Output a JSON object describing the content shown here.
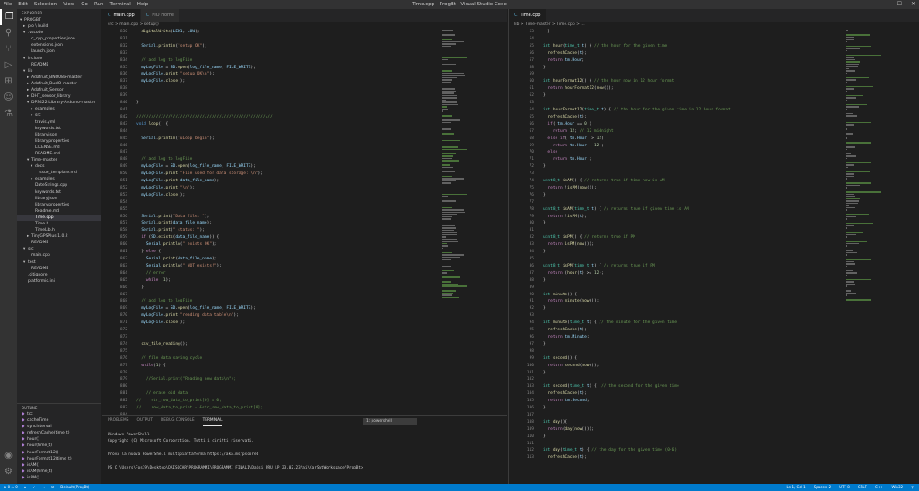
{
  "titlebar": {
    "menu": [
      "File",
      "Edit",
      "Selection",
      "View",
      "Go",
      "Run",
      "Terminal",
      "Help"
    ],
    "title": "Time.cpp - ProgBt - Visual Studio Code"
  },
  "sidebar": {
    "header": "EXPLORER",
    "tree": [
      [
        "▾",
        "PROGBT"
      ],
      [
        "▸",
        "pio \\ build"
      ],
      [
        "▾",
        ".vscode"
      ],
      [
        "",
        "c_cpp_properties.json"
      ],
      [
        "",
        "extensions.json"
      ],
      [
        "",
        "launch.json"
      ],
      [
        "▾",
        "include"
      ],
      [
        "",
        "README"
      ],
      [
        "▾",
        "lib"
      ],
      [
        "▸",
        "Adafruit_BNO08x-master"
      ],
      [
        "▸",
        "Adafruit_BusIO-master"
      ],
      [
        "▸",
        "Adafruit_Sensor"
      ],
      [
        "▸",
        "DHT_sensor_library"
      ],
      [
        "▾",
        "DPS422-Library-Arduino-master"
      ],
      [
        "▸",
        "examples"
      ],
      [
        "▸",
        "src"
      ],
      [
        "",
        "travis.yml"
      ],
      [
        "",
        "keywords.txt"
      ],
      [
        "",
        "library.json"
      ],
      [
        "",
        "library.properties"
      ],
      [
        "",
        "LICENSE.md"
      ],
      [
        "",
        "README.md"
      ],
      [
        "▾",
        "Time-master"
      ],
      [
        "▾",
        "docs"
      ],
      [
        "",
        "issue_template.md"
      ],
      [
        "▸",
        "examples"
      ],
      [
        "",
        "DateStrings.cpp"
      ],
      [
        "",
        "keywords.txt"
      ],
      [
        "",
        "library.json"
      ],
      [
        "",
        "library.properties"
      ],
      [
        "",
        "Readme.md"
      ],
      [
        "",
        "Time.cpp"
      ],
      [
        "",
        "Time.h"
      ],
      [
        "",
        "TimeLib.h"
      ],
      [
        "▸",
        "TinyGPSPlus-1.0.2"
      ],
      [
        "",
        "README"
      ],
      [
        "▾",
        "src"
      ],
      [
        "",
        "main.cpp"
      ],
      [
        "▾",
        "test"
      ],
      [
        "",
        "README"
      ],
      [
        "",
        ".gitignore"
      ],
      [
        "",
        "platformio.ini"
      ]
    ],
    "outline_header": "OUTLINE",
    "outline": [
      "tcc",
      "cacheTime",
      "syncInterval",
      "refreshCache(time_t)",
      "hour()",
      "hour(time_t)",
      "hourFormat12()",
      "hourFormat12(time_t)",
      "isAM()",
      "isAM(time_t)",
      "isPM()"
    ]
  },
  "editor1": {
    "tabs": [
      "main.cpp",
      "PIO Home"
    ],
    "crumb": "src > main.cpp > setup()"
  },
  "editor2": {
    "tabs": [
      "Time.cpp"
    ],
    "crumb": "lib > Time-master > Time.cpp > ..."
  },
  "panel": {
    "tabs": [
      "PROBLEMS",
      "OUTPUT",
      "DEBUG CONSOLE",
      "TERMINAL"
    ],
    "terminal_select": "1: powershell",
    "terminal": [
      "Windows PowerShell",
      "Copyright (C) Microsoft Corporation. Tutti i diritti riservati.",
      "",
      "Prova la nuova PowerShell multipiattaforma https://aka.ms/pscore6",
      "",
      "PS C:\\Users\\Fos19\\Desktop\\DAISOCAR\\PROGRAMMI\\PROGRAMMI FINALI\\Daisi_PRU_LP_23.02.23\\ai\\CarSatWorkspace\\ProgBt> "
    ]
  },
  "status": {
    "left": [
      "⊗ 0  ⚠ 0",
      "⌂",
      "✓",
      "→",
      "⎋",
      "Default (ProgBt)"
    ],
    "right": [
      "Ln 1, Col 1",
      "Spaces: 2",
      "UTF-8",
      "CRLF",
      "C++",
      "Win32",
      "⚲"
    ]
  },
  "code1": [
    [
      "830",
      "  <span class=\"fn\">digitalWrite</span>(<span class=\"vr\">LED1</span>, <span class=\"vr\">LOW</span>);"
    ],
    [
      "831",
      ""
    ],
    [
      "832",
      "  <span class=\"vr\">Serial</span>.<span class=\"fn\">println</span>(<span class=\"st\">\"setup OK\"</span>);"
    ],
    [
      "833",
      ""
    ],
    [
      "834",
      "  <span class=\"cm\">// add log to logFile</span>"
    ],
    [
      "835",
      "  <span class=\"vr\">myLogFile</span> = <span class=\"vr\">SD</span>.<span class=\"fn\">open</span>(<span class=\"vr\">log_file_name</span>, <span class=\"vr\">FILE_WRITE</span>);"
    ],
    [
      "836",
      "  <span class=\"vr\">myLogFile</span>.<span class=\"fn\">print</span>(<span class=\"st\">\"setup OK\\n\"</span>);"
    ],
    [
      "837",
      "  <span class=\"vr\">myLogFile</span>.<span class=\"fn\">close</span>();"
    ],
    [
      "838",
      ""
    ],
    [
      "839",
      ""
    ],
    [
      "840",
      "}"
    ],
    [
      "841",
      ""
    ],
    [
      "842",
      "<span class=\"cm\">////////////////////////////////////////////////////////</span>"
    ],
    [
      "843",
      "<span class=\"kw\">void</span> <span class=\"fn\">loop</span>() {"
    ],
    [
      "844",
      ""
    ],
    [
      "845",
      "  <span class=\"vr\">Serial</span>.<span class=\"fn\">println</span>(<span class=\"st\">\"uLoop begin\"</span>);"
    ],
    [
      "846",
      ""
    ],
    [
      "847",
      ""
    ],
    [
      "848",
      "  <span class=\"cm\">// add log to logFile</span>"
    ],
    [
      "849",
      "  <span class=\"vr\">myLogFile</span> = <span class=\"vr\">SD</span>.<span class=\"fn\">open</span>(<span class=\"vr\">log_file_name</span>, <span class=\"vr\">FILE_WRITE</span>);"
    ],
    [
      "850",
      "  <span class=\"vr\">myLogFile</span>.<span class=\"fn\">print</span>(<span class=\"st\">\"File used for data storage: \\n\"</span>);"
    ],
    [
      "851",
      "  <span class=\"vr\">myLogFile</span>.<span class=\"fn\">print</span>(<span class=\"vr\">data_file_name</span>);"
    ],
    [
      "852",
      "  <span class=\"vr\">myLogFile</span>.<span class=\"fn\">print</span>(<span class=\"st\">\"\\n\"</span>);"
    ],
    [
      "853",
      "  <span class=\"vr\">myLogFile</span>.<span class=\"fn\">close</span>();"
    ],
    [
      "854",
      ""
    ],
    [
      "855",
      ""
    ],
    [
      "856",
      "  <span class=\"vr\">Serial</span>.<span class=\"fn\">print</span>(<span class=\"st\">\"Data file: \"</span>);"
    ],
    [
      "857",
      "  <span class=\"vr\">Serial</span>.<span class=\"fn\">print</span>(<span class=\"vr\">data_file_name</span>);"
    ],
    [
      "858",
      "  <span class=\"vr\">Serial</span>.<span class=\"fn\">print</span>(<span class=\"st\">\" status: \"</span>);"
    ],
    [
      "859",
      "  <span class=\"pp\">if</span> (<span class=\"vr\">SD</span>.<span class=\"fn\">exists</span>(<span class=\"vr\">data_file_name</span>)) {"
    ],
    [
      "860",
      "    <span class=\"vr\">Serial</span>.<span class=\"fn\">println</span>(<span class=\"st\">\" exists OK\"</span>);"
    ],
    [
      "861",
      "  } <span class=\"pp\">else</span> {"
    ],
    [
      "862",
      "    <span class=\"vr\">Serial</span>.<span class=\"fn\">print</span>(<span class=\"vr\">data_file_name</span>);"
    ],
    [
      "863",
      "    <span class=\"vr\">Serial</span>.<span class=\"fn\">println</span>(<span class=\"st\">\" NOT exists!\"</span>);"
    ],
    [
      "864",
      "    <span class=\"cm\">// error</span>"
    ],
    [
      "865",
      "    <span class=\"pp\">while</span> (<span class=\"nu\">1</span>);"
    ],
    [
      "866",
      "  }"
    ],
    [
      "867",
      ""
    ],
    [
      "868",
      "  <span class=\"cm\">// add log to logFile</span>"
    ],
    [
      "869",
      "  <span class=\"vr\">myLogFile</span> = <span class=\"vr\">SD</span>.<span class=\"fn\">open</span>(<span class=\"vr\">log_file_name</span>, <span class=\"vr\">FILE_WRITE</span>);"
    ],
    [
      "870",
      "  <span class=\"vr\">myLogFile</span>.<span class=\"fn\">print</span>(<span class=\"st\">\"reading data table\\n\"</span>);"
    ],
    [
      "871",
      "  <span class=\"vr\">myLogFile</span>.<span class=\"fn\">close</span>();"
    ],
    [
      "872",
      ""
    ],
    [
      "873",
      ""
    ],
    [
      "874",
      "  <span class=\"fn\">csv_file_reading</span>();"
    ],
    [
      "875",
      ""
    ],
    [
      "876",
      "  <span class=\"cm\">// file data saving cycle</span>"
    ],
    [
      "877",
      "  <span class=\"pp\">while</span>(<span class=\"nu\">1</span>) {"
    ],
    [
      "878",
      ""
    ],
    [
      "879",
      "    <span class=\"cm\">//Serial.print(\"Reading new data\\n\");</span>"
    ],
    [
      "880",
      ""
    ],
    [
      "881",
      "    <span class=\"cm\">// erase old data</span>"
    ],
    [
      "882",
      "<span class=\"cm\">//    str_row_data_to_print[0] = 0;</span>"
    ],
    [
      "883",
      "<span class=\"cm\">//    row_data_to_print = &amp;str_row_data_to_print[0];</span>"
    ],
    [
      "884",
      ""
    ],
    [
      "885",
      "    <span class=\"cm\">//Serial.print(\"consaE: \");</span>"
    ],
    [
      "886",
      "    <span class=\"cm\">//prevTime = millis();</span>"
    ],
    [
      "887",
      "    <span class=\"fn\">read_sensors_data</span>();"
    ],
    [
      "888",
      "    <span class=\"cm\">//Serial.println(millis()-prevTime);</span>"
    ],
    [
      "889",
      ""
    ],
    [
      "890",
      "    <span class=\"cm\">// debug print</span>"
    ]
  ],
  "code2": [
    [
      "53",
      "  }"
    ],
    [
      "54",
      ""
    ],
    [
      "55",
      "<span class=\"ty\">int</span> <span class=\"fn\">hour</span>(<span class=\"ty\">time_t</span> <span class=\"vr\">t</span>) { <span class=\"cm\">// the hour for the given time</span>"
    ],
    [
      "56",
      "  <span class=\"fn\">refreshCache</span>(<span class=\"vr\">t</span>);"
    ],
    [
      "57",
      "  <span class=\"pp\">return</span> <span class=\"vr\">tm</span>.<span class=\"vr\">Hour</span>;"
    ],
    [
      "58",
      "}"
    ],
    [
      "59",
      ""
    ],
    [
      "60",
      "<span class=\"ty\">int</span> <span class=\"fn\">hourFormat12</span>() { <span class=\"cm\">// the hour now in 12 hour format</span>"
    ],
    [
      "61",
      "  <span class=\"pp\">return</span> <span class=\"fn\">hourFormat12</span>(<span class=\"fn\">now</span>());"
    ],
    [
      "62",
      "}"
    ],
    [
      "63",
      ""
    ],
    [
      "64",
      "<span class=\"ty\">int</span> <span class=\"fn\">hourFormat12</span>(<span class=\"ty\">time_t</span> <span class=\"vr\">t</span>) { <span class=\"cm\">// the hour for the given time in 12 hour format</span>"
    ],
    [
      "65",
      "  <span class=\"fn\">refreshCache</span>(<span class=\"vr\">t</span>);"
    ],
    [
      "66",
      "  <span class=\"pp\">if</span>( <span class=\"vr\">tm</span>.<span class=\"vr\">Hour</span> == <span class=\"nu\">0</span> )"
    ],
    [
      "67",
      "    <span class=\"pp\">return</span> <span class=\"nu\">12</span>; <span class=\"cm\">// 12 midnight</span>"
    ],
    [
      "68",
      "  <span class=\"pp\">else if</span>( <span class=\"vr\">tm</span>.<span class=\"vr\">Hour</span>  &gt; <span class=\"nu\">12</span>)"
    ],
    [
      "69",
      "    <span class=\"pp\">return</span> <span class=\"vr\">tm</span>.<span class=\"vr\">Hour</span> - <span class=\"nu\">12</span> ;"
    ],
    [
      "70",
      "  <span class=\"pp\">else</span>"
    ],
    [
      "71",
      "    <span class=\"pp\">return</span> <span class=\"vr\">tm</span>.<span class=\"vr\">Hour</span> ;"
    ],
    [
      "72",
      "}"
    ],
    [
      "73",
      ""
    ],
    [
      "74",
      "<span class=\"ty\">uint8_t</span> <span class=\"fn\">isAM</span>() { <span class=\"cm\">// returns true if time now is AM</span>"
    ],
    [
      "75",
      "  <span class=\"pp\">return</span> !<span class=\"fn\">isPM</span>(<span class=\"fn\">now</span>());"
    ],
    [
      "76",
      "}"
    ],
    [
      "77",
      ""
    ],
    [
      "78",
      "<span class=\"ty\">uint8_t</span> <span class=\"fn\">isAM</span>(<span class=\"ty\">time_t</span> <span class=\"vr\">t</span>) { <span class=\"cm\">// returns true if given time is AM</span>"
    ],
    [
      "79",
      "  <span class=\"pp\">return</span> !<span class=\"fn\">isPM</span>(<span class=\"vr\">t</span>);"
    ],
    [
      "80",
      "}"
    ],
    [
      "81",
      ""
    ],
    [
      "82",
      "<span class=\"ty\">uint8_t</span> <span class=\"fn\">isPM</span>() { <span class=\"cm\">// returns true if PM</span>"
    ],
    [
      "83",
      "  <span class=\"pp\">return</span> <span class=\"fn\">isPM</span>(<span class=\"fn\">now</span>());"
    ],
    [
      "84",
      "}"
    ],
    [
      "85",
      ""
    ],
    [
      "86",
      "<span class=\"ty\">uint8_t</span> <span class=\"fn\">isPM</span>(<span class=\"ty\">time_t</span> <span class=\"vr\">t</span>) { <span class=\"cm\">// returns true if PM</span>"
    ],
    [
      "87",
      "  <span class=\"pp\">return</span> (<span class=\"fn\">hour</span>(<span class=\"vr\">t</span>) &gt;= <span class=\"nu\">12</span>);"
    ],
    [
      "88",
      "}"
    ],
    [
      "89",
      ""
    ],
    [
      "90",
      "<span class=\"ty\">int</span> <span class=\"fn\">minute</span>() {"
    ],
    [
      "91",
      "  <span class=\"pp\">return</span> <span class=\"fn\">minute</span>(<span class=\"fn\">now</span>());"
    ],
    [
      "92",
      "}"
    ],
    [
      "93",
      ""
    ],
    [
      "94",
      "<span class=\"ty\">int</span> <span class=\"fn\">minute</span>(<span class=\"ty\">time_t</span> <span class=\"vr\">t</span>) { <span class=\"cm\">// the minute for the given time</span>"
    ],
    [
      "95",
      "  <span class=\"fn\">refreshCache</span>(<span class=\"vr\">t</span>);"
    ],
    [
      "96",
      "  <span class=\"pp\">return</span> <span class=\"vr\">tm</span>.<span class=\"vr\">Minute</span>;"
    ],
    [
      "97",
      "}"
    ],
    [
      "98",
      ""
    ],
    [
      "99",
      "<span class=\"ty\">int</span> <span class=\"fn\">second</span>() {"
    ],
    [
      "100",
      "  <span class=\"pp\">return</span> <span class=\"fn\">second</span>(<span class=\"fn\">now</span>());"
    ],
    [
      "101",
      "}"
    ],
    [
      "102",
      ""
    ],
    [
      "103",
      "<span class=\"ty\">int</span> <span class=\"fn\">second</span>(<span class=\"ty\">time_t</span> <span class=\"vr\">t</span>) {  <span class=\"cm\">// the second for the given time</span>"
    ],
    [
      "104",
      "  <span class=\"fn\">refreshCache</span>(<span class=\"vr\">t</span>);"
    ],
    [
      "105",
      "  <span class=\"pp\">return</span> <span class=\"vr\">tm</span>.<span class=\"vr\">Second</span>;"
    ],
    [
      "106",
      "}"
    ],
    [
      "107",
      ""
    ],
    [
      "108",
      "<span class=\"ty\">int</span> <span class=\"fn\">day</span>(){"
    ],
    [
      "109",
      "  <span class=\"pp\">return</span>(<span class=\"fn\">day</span>(<span class=\"fn\">now</span>()));"
    ],
    [
      "110",
      "}"
    ],
    [
      "111",
      ""
    ],
    [
      "112",
      "<span class=\"ty\">int</span> <span class=\"fn\">day</span>(<span class=\"ty\">time_t</span> <span class=\"vr\">t</span>) { <span class=\"cm\">// the day for the given time (0-6)</span>"
    ],
    [
      "113",
      "  <span class=\"fn\">refreshCache</span>(<span class=\"vr\">t</span>);"
    ]
  ]
}
